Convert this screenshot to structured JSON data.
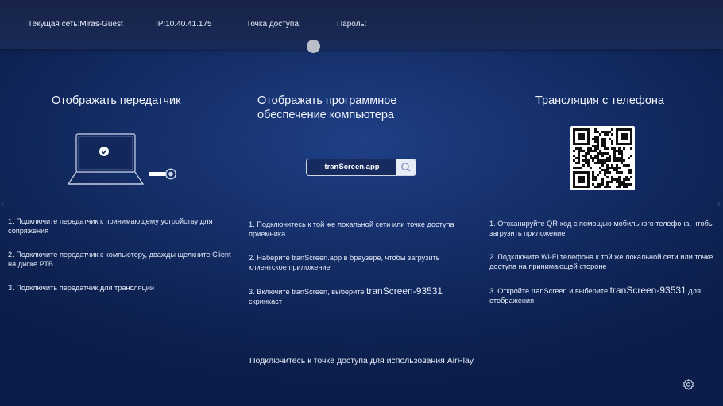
{
  "topbar": {
    "network_label": "Текущая сеть:Miras-Guest",
    "ip_label": "IP:10.40.41.175",
    "hotspot_label": "Точка доступа:",
    "password_label": "Пароль:"
  },
  "columns": {
    "transmitter": {
      "title": "Отображать передатчик",
      "steps": [
        "1. Подключите передатчик к принимающему устройству для сопряжения",
        "2. Подключите передатчик к компьютеру, дважды щелкните Client на диске РТВ",
        "3. Подключить передатчик для трансляции"
      ]
    },
    "software": {
      "title_line1": "Отображать программное",
      "title_line2": "обеспечение компьютера",
      "search_text": "tranScreen.app",
      "steps": [
        "1. Подключитесь к той же локальной сети или точке доступа приемника",
        "2. Наберите tranScreen.app в браузере, чтобы загрузить клиентское приложение"
      ],
      "step3_prefix": "3. Включите tranScreen, выберите ",
      "step3_code": "tranScreen-93531",
      "step3_suffix": "скринкаст"
    },
    "phone": {
      "title": "Трансляция с телефона",
      "steps": [
        "1. Отсканируйте QR-код с помощью мобильного телефона, чтобы загрузить приложение",
        "2. Подключите Wi-Fi телефона к той же локальной сети или точке доступа на принимающей стороне"
      ],
      "step3_prefix": "3. Откройте tranScreen и выберите ",
      "step3_code": "tranScreen-93531",
      "step3_suffix": " для отображения"
    }
  },
  "footer": {
    "airplay_note": "Подключитесь к точке доступа для использования AirPlay"
  },
  "icons": {
    "settings": "gear-icon",
    "search": "search-icon",
    "laptop": "laptop-icon",
    "dongle": "dongle-icon",
    "qr": "qr-code"
  },
  "colors": {
    "background": "#16306b",
    "topbar": "#1a2b58",
    "text": "#e8eefc"
  }
}
